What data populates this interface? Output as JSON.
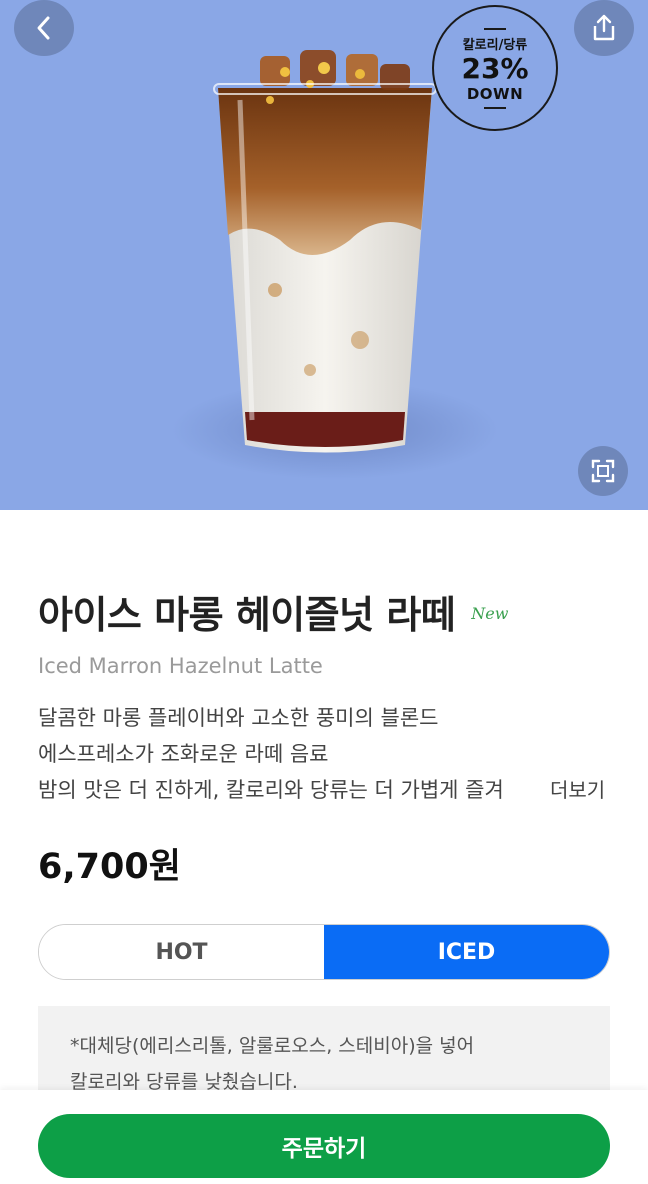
{
  "badge": {
    "line1": "칼로리/당류",
    "percent": "23%",
    "line3": "DOWN"
  },
  "product": {
    "name": "아이스 마롱 헤이즐넛 라떼",
    "new_label": "New",
    "english_name": "Iced Marron Hazelnut Latte",
    "description_lines": [
      "달콤한 마롱 플레이버와 고소한 풍미의 블론드",
      "에스프레소가 조화로운 라떼 음료",
      "밤의 맛은 더 진하게, 칼로리와 당류는 더 가볍게 즐겨"
    ],
    "more_label": "더보기",
    "price": "6,700원"
  },
  "temperature": {
    "options": [
      "HOT",
      "ICED"
    ],
    "selected": "ICED"
  },
  "notice": {
    "lines": [
      "*대체당(에리스리톨, 알룰로오스, 스테비아)을 넣어",
      "칼로리와 당류를 낮췄습니다."
    ]
  },
  "order_button_label": "주문하기",
  "colors": {
    "hero_bg": "#8aa7e6",
    "accent_green": "#0d9f47",
    "selected_blue": "#0a6cf5",
    "new_green": "#3aa04f"
  },
  "icons": {
    "back": "chevron-left-icon",
    "share": "share-icon",
    "zoom": "fullscreen-icon"
  }
}
